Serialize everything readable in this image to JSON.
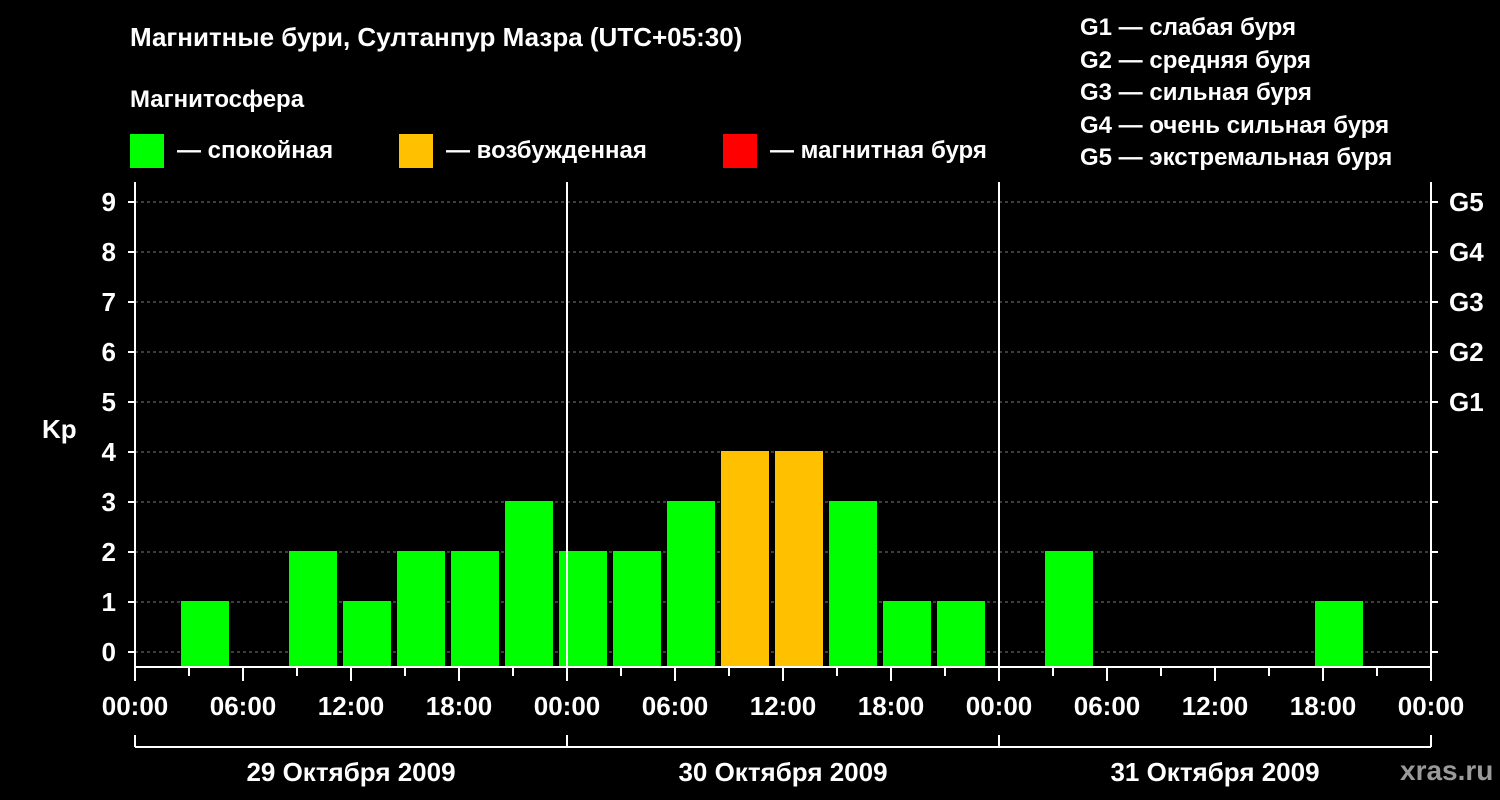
{
  "title": "Магнитные бури, Султанпур Мазра (UTC+05:30)",
  "subtitle": "Магнитосфера",
  "legend": [
    {
      "color": "#00ff00",
      "label": "— спокойная"
    },
    {
      "color": "#ffc000",
      "label": "— возбужденная"
    },
    {
      "color": "#ff0000",
      "label": "— магнитная буря"
    }
  ],
  "storm_scale": [
    "G1 — слабая буря",
    "G2 — средняя буря",
    "G3 — сильная буря",
    "G4 — очень сильная буря",
    "G5 — экстремальная буря"
  ],
  "watermark": "xras.ru",
  "chart_data": {
    "type": "bar",
    "ylabel": "Kp",
    "ylim": [
      0,
      9
    ],
    "yticks": [
      "0",
      "1",
      "2",
      "3",
      "4",
      "5",
      "6",
      "7",
      "8",
      "9"
    ],
    "right_axis": [
      {
        "value": 5,
        "label": "G1"
      },
      {
        "value": 6,
        "label": "G2"
      },
      {
        "value": 7,
        "label": "G3"
      },
      {
        "value": 8,
        "label": "G4"
      },
      {
        "value": 9,
        "label": "G5"
      }
    ],
    "xticks": [
      "00:00",
      "06:00",
      "12:00",
      "18:00",
      "00:00",
      "06:00",
      "12:00",
      "18:00",
      "00:00",
      "06:00",
      "12:00",
      "18:00",
      "00:00"
    ],
    "days": [
      "29 Октября 2009",
      "30 Октября 2009",
      "31 Октября 2009"
    ],
    "grid": "horizontal dashed",
    "colors": {
      "quiet": "#00ff00",
      "active": "#ffc000",
      "storm": "#ff0000"
    },
    "bars": [
      {
        "start_hour": 2.5,
        "kp": 1,
        "level": "quiet"
      },
      {
        "start_hour": 8.5,
        "kp": 2,
        "level": "quiet"
      },
      {
        "start_hour": 11.5,
        "kp": 1,
        "level": "quiet"
      },
      {
        "start_hour": 14.5,
        "kp": 2,
        "level": "quiet"
      },
      {
        "start_hour": 17.5,
        "kp": 2,
        "level": "quiet"
      },
      {
        "start_hour": 20.5,
        "kp": 3,
        "level": "quiet"
      },
      {
        "start_hour": 23.5,
        "kp": 2,
        "level": "quiet"
      },
      {
        "start_hour": 26.5,
        "kp": 2,
        "level": "quiet"
      },
      {
        "start_hour": 29.5,
        "kp": 3,
        "level": "quiet"
      },
      {
        "start_hour": 32.5,
        "kp": 4,
        "level": "active"
      },
      {
        "start_hour": 35.5,
        "kp": 4,
        "level": "active"
      },
      {
        "start_hour": 38.5,
        "kp": 3,
        "level": "quiet"
      },
      {
        "start_hour": 41.5,
        "kp": 1,
        "level": "quiet"
      },
      {
        "start_hour": 44.5,
        "kp": 1,
        "level": "quiet"
      },
      {
        "start_hour": 50.5,
        "kp": 2,
        "level": "quiet"
      },
      {
        "start_hour": 65.5,
        "kp": 1,
        "level": "quiet"
      }
    ]
  }
}
